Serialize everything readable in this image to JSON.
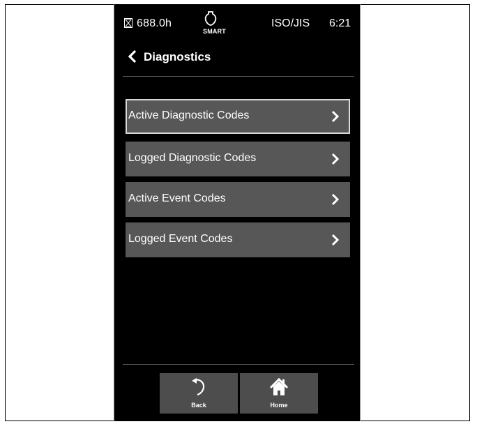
{
  "status_bar": {
    "hours": "688.0h",
    "smart_label": "SMART",
    "mode": "ISO/JIS",
    "time": "6:21"
  },
  "header": {
    "title": "Diagnostics"
  },
  "menu": {
    "items": [
      {
        "label": "Active Diagnostic Codes",
        "selected": true
      },
      {
        "label": "Logged Diagnostic Codes",
        "selected": false
      },
      {
        "label": "Active Event Codes",
        "selected": false
      },
      {
        "label": "Logged Event Codes",
        "selected": false
      }
    ]
  },
  "nav": {
    "back_label": "Back",
    "home_label": "Home"
  },
  "colors": {
    "screen_bg": "#000000",
    "button_bg": "#575757",
    "nav_button_bg": "#4d4d4d",
    "selected_border": "#d9d9d9",
    "text": "#ffffff"
  }
}
